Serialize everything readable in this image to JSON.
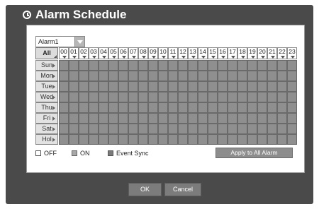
{
  "window": {
    "title": "Alarm Schedule"
  },
  "alarm_select": {
    "value": "Alarm1"
  },
  "grid": {
    "all_label": "All",
    "hours": [
      "00",
      "01",
      "02",
      "03",
      "04",
      "05",
      "06",
      "07",
      "08",
      "09",
      "10",
      "11",
      "12",
      "13",
      "14",
      "15",
      "16",
      "17",
      "18",
      "19",
      "20",
      "21",
      "22",
      "23"
    ],
    "days": [
      "Sun",
      "Mon",
      "Tue",
      "Wed",
      "Thu",
      "Fri",
      "Sat",
      "Hol"
    ],
    "cell_state": "ON"
  },
  "legend": {
    "off": "OFF",
    "on": "ON",
    "event": "Event Sync"
  },
  "apply_all_label": "Apply to All Alarm",
  "footer": {
    "ok": "OK",
    "cancel": "Cancel"
  }
}
